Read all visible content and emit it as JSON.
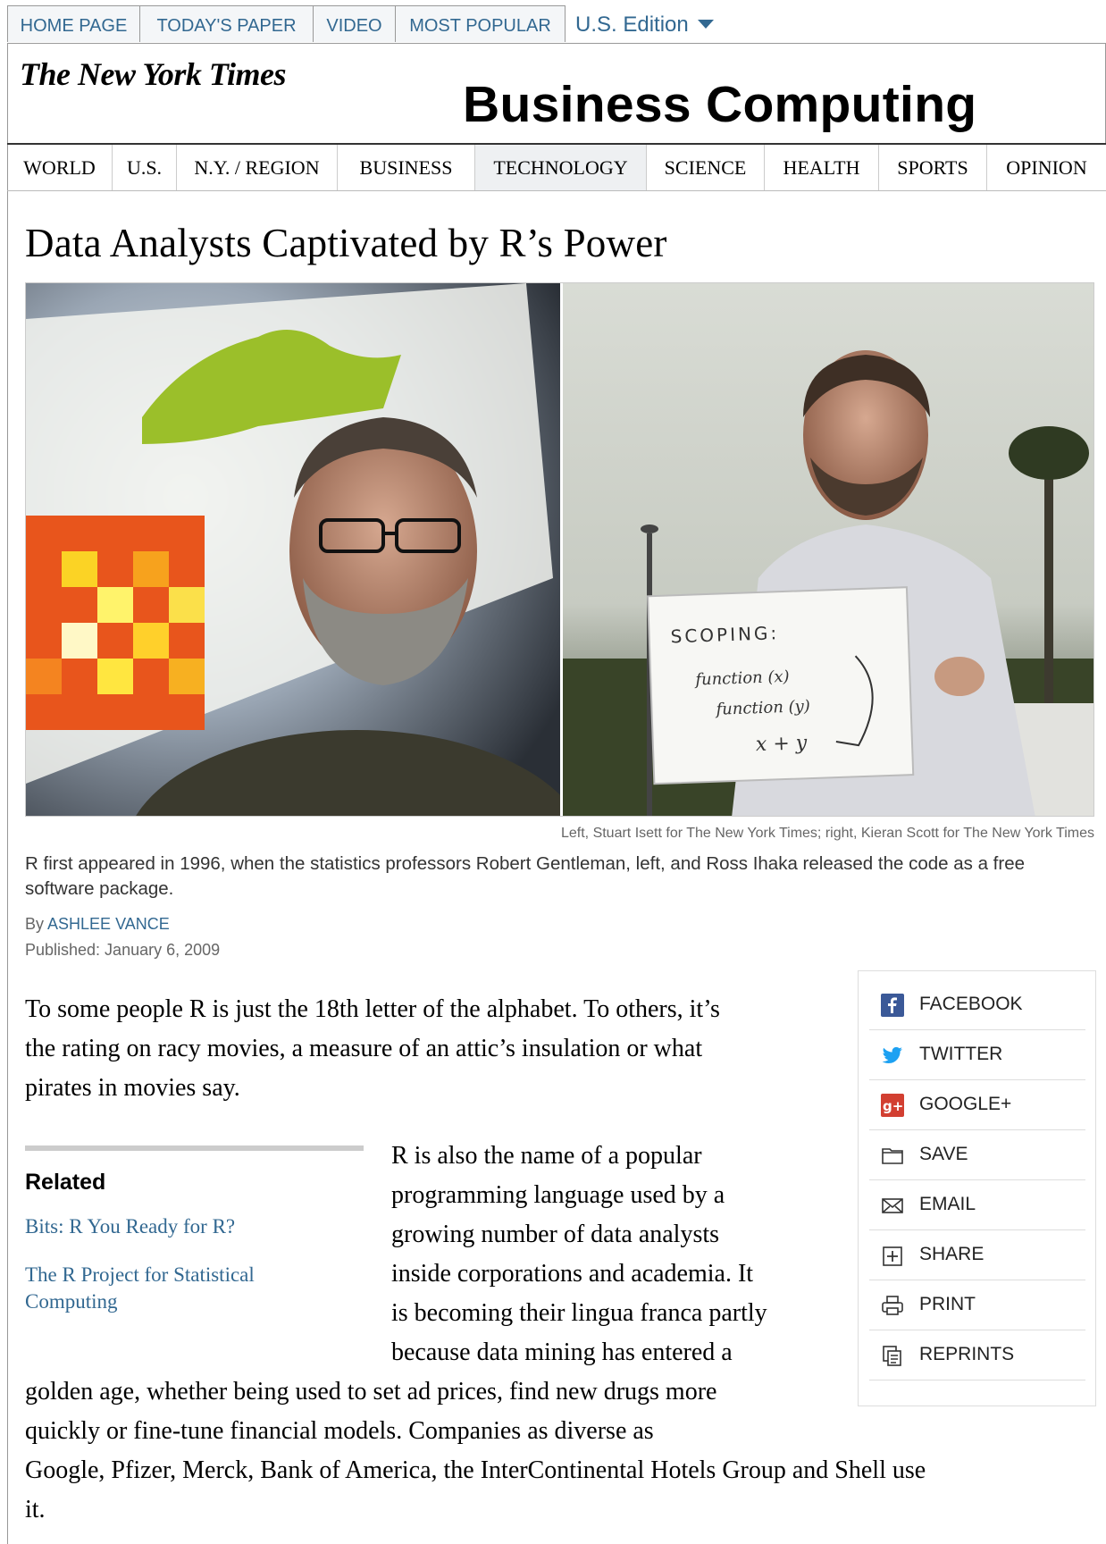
{
  "top_nav": {
    "tabs": [
      "HOME PAGE",
      "TODAY'S PAPER",
      "VIDEO",
      "MOST POPULAR"
    ],
    "edition": "U.S. Edition"
  },
  "header": {
    "logo": "The New York Times",
    "section_title": "Business Computing"
  },
  "section_nav": {
    "items": [
      "WORLD",
      "U.S.",
      "N.Y. / REGION",
      "BUSINESS",
      "TECHNOLOGY",
      "SCIENCE",
      "HEALTH",
      "SPORTS",
      "OPINION"
    ],
    "active": "TECHNOLOGY"
  },
  "article": {
    "headline": "Data Analysts Captivated by R’s Power",
    "photo_credit": "Left, Stuart Isett for The New York Times; right, Kieran Scott for The New York Times",
    "caption": "R first appeared in 1996, when the statistics professors Robert Gentleman, left, and Ross Ihaka released the code as a free software package.",
    "byline_prefix": "By",
    "author": "ASHLEE VANCE",
    "published": "Published: January 6, 2009",
    "whiteboard": {
      "title": "SCOPING:",
      "line1": "function (x)",
      "line2": "function (y)",
      "line3": "x + y"
    },
    "para1_lines": [
      "To some people R is just the 18th letter of the alphabet. To others, it’s",
      "the rating on racy movies, a measure of an attic’s insulation or what",
      "pirates in movies say."
    ],
    "para2_lines": [
      "R is also the name of a popular",
      "programming language used by a",
      "growing number of data analysts",
      "inside corporations and academia. It",
      "is becoming their lingua franca partly",
      "because data mining has entered a",
      "golden age, whether being used to set ad prices, find new drugs more",
      "quickly or fine-tune financial models. Companies as diverse as",
      "Google, Pfizer, Merck, Bank of America, the InterContinental Hotels Group and Shell use",
      "it."
    ]
  },
  "related": {
    "title": "Related",
    "links": [
      "Bits: R You Ready for R?",
      "The R Project for Statistical Computing"
    ]
  },
  "share_tools": [
    {
      "label": "FACEBOOK",
      "icon": "facebook-icon"
    },
    {
      "label": "TWITTER",
      "icon": "twitter-icon"
    },
    {
      "label": "GOOGLE+",
      "icon": "google-plus-icon"
    },
    {
      "label": "SAVE",
      "icon": "save-icon"
    },
    {
      "label": "EMAIL",
      "icon": "email-icon"
    },
    {
      "label": "SHARE",
      "icon": "share-icon"
    },
    {
      "label": "PRINT",
      "icon": "print-icon"
    },
    {
      "label": "REPRINTS",
      "icon": "reprints-icon"
    }
  ],
  "colors": {
    "link": "#326891",
    "facebook": "#3b5998",
    "twitter": "#1da1f2",
    "google": "#d23f31"
  }
}
